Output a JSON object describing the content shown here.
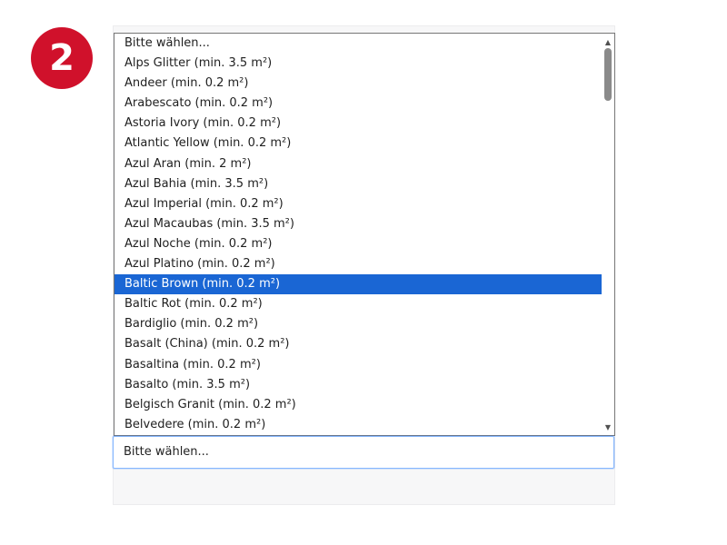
{
  "step": {
    "number": "2"
  },
  "colors": {
    "badge": "#d0112b",
    "selection": "#1a66d4",
    "focus_border": "#86b7fe"
  },
  "select": {
    "current_value": "Bitte wählen...",
    "selected_index": 12,
    "options": [
      "Bitte wählen...",
      "Alps Glitter (min. 3.5 m²)",
      "Andeer (min. 0.2 m²)",
      "Arabescato (min. 0.2 m²)",
      "Astoria Ivory (min. 0.2 m²)",
      "Atlantic Yellow (min. 0.2 m²)",
      "Azul Aran (min. 2 m²)",
      "Azul Bahia (min. 3.5 m²)",
      "Azul Imperial (min. 0.2 m²)",
      "Azul Macaubas (min. 3.5 m²)",
      "Azul Noche (min. 0.2 m²)",
      "Azul Platino (min. 0.2 m²)",
      "Baltic Brown (min. 0.2 m²)",
      "Baltic Rot (min. 0.2 m²)",
      "Bardiglio (min. 0.2 m²)",
      "Basalt (China) (min. 0.2 m²)",
      "Basaltina (min. 0.2 m²)",
      "Basalto (min. 3.5 m²)",
      "Belgisch Granit (min. 0.2 m²)",
      "Belvedere (min. 0.2 m²)"
    ]
  },
  "scrollbar": {
    "up_icon": "scroll-up-arrow-icon",
    "down_icon": "scroll-down-arrow-icon",
    "position": 0
  }
}
